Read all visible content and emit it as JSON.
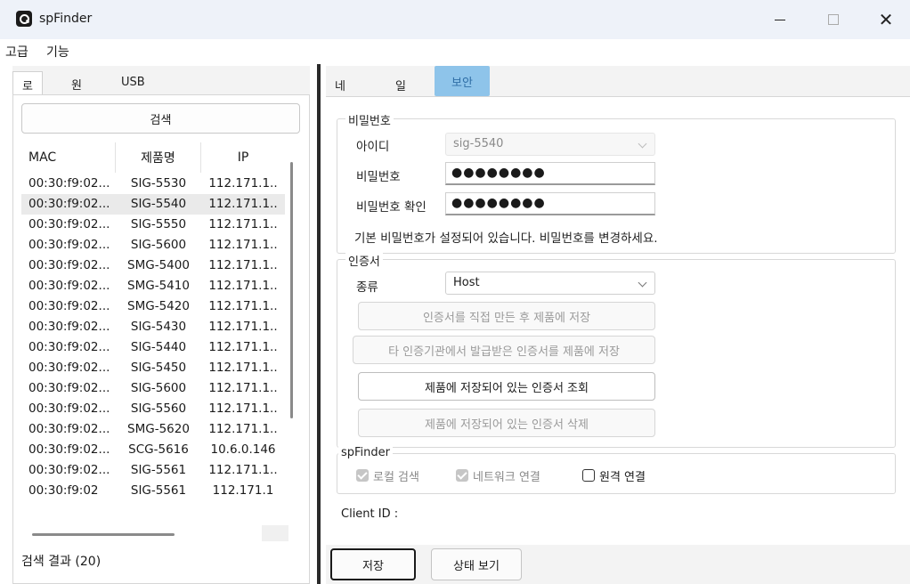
{
  "window": {
    "title": "spFinder"
  },
  "menu": {
    "items": [
      "고급",
      "기능"
    ]
  },
  "left": {
    "tabs": [
      "로컬",
      "원격",
      "USB"
    ],
    "search_button": "검색",
    "columns": [
      "MAC",
      "제품명",
      "IP"
    ],
    "rows": [
      {
        "mac": "00:30:f9:02...",
        "name": "SIG-5530",
        "ip": "112.171.1.."
      },
      {
        "mac": "00:30:f9:02...",
        "name": "SIG-5540",
        "ip": "112.171.1.."
      },
      {
        "mac": "00:30:f9:02...",
        "name": "SIG-5550",
        "ip": "112.171.1.."
      },
      {
        "mac": "00:30:f9:02...",
        "name": "SIG-5600",
        "ip": "112.171.1.."
      },
      {
        "mac": "00:30:f9:02...",
        "name": "SMG-5400",
        "ip": "112.171.1.."
      },
      {
        "mac": "00:30:f9:02...",
        "name": "SMG-5410",
        "ip": "112.171.1.."
      },
      {
        "mac": "00:30:f9:02...",
        "name": "SMG-5420",
        "ip": "112.171.1.."
      },
      {
        "mac": "00:30:f9:02...",
        "name": "SIG-5430",
        "ip": "112.171.1.."
      },
      {
        "mac": "00:30:f9:02...",
        "name": "SIG-5440",
        "ip": "112.171.1.."
      },
      {
        "mac": "00:30:f9:02...",
        "name": "SIG-5450",
        "ip": "112.171.1.."
      },
      {
        "mac": "00:30:f9:02...",
        "name": "SIG-5600",
        "ip": "112.171.1.."
      },
      {
        "mac": "00:30:f9:02...",
        "name": "SIG-5560",
        "ip": "112.171.1.."
      },
      {
        "mac": "00:30:f9:02...",
        "name": "SMG-5620",
        "ip": "112.171.1.."
      },
      {
        "mac": "00:30:f9:02...",
        "name": "SCG-5616",
        "ip": "10.6.0.146"
      },
      {
        "mac": "00:30:f9:02...",
        "name": "SIG-5561",
        "ip": "112.171.1.."
      },
      {
        "mac": "00:30:f9:02",
        "name": "SIG-5561",
        "ip": "112.171.1"
      }
    ],
    "selected_row": 1,
    "result_text": "검색 결과 (20)"
  },
  "right": {
    "tabs": [
      "네트워크",
      "일반",
      "보안"
    ],
    "active_tab": "보안",
    "password_group": {
      "title": "비밀번호",
      "id_label": "아이디",
      "id_value": "sig-5540",
      "pw_label": "비밀번호",
      "pw_value": "●●●●●●●●",
      "pw_confirm_label": "비밀번호 확인",
      "pw_confirm_value": "●●●●●●●●",
      "notice": "기본 비밀번호가 설정되어 있습니다. 비밀번호를 변경하세요."
    },
    "cert_group": {
      "title": "인증서",
      "type_label": "종류",
      "type_value": "Host",
      "btn_create": "인증서를 직접 만든 후 제품에 저장",
      "btn_external": "타 인증기관에서 발급받은 인증서를 제품에 저장",
      "btn_view": "제품에 저장되어 있는 인증서 조회",
      "btn_delete": "제품에 저장되어 있는 인증서 삭제"
    },
    "spfinder_group": {
      "title": "spFinder",
      "local_search": "로컬 검색",
      "network_connect": "네트워크 연결",
      "remote_connect": "원격 연결"
    },
    "client_id_label": "Client ID :",
    "save_button": "저장",
    "status_button": "상태 보기"
  }
}
